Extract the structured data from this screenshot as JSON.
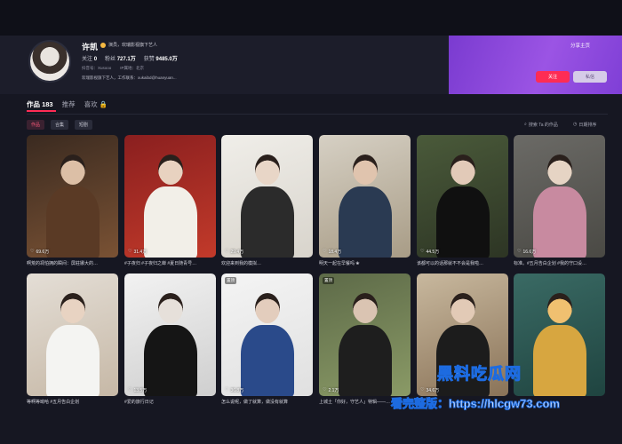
{
  "profile": {
    "name": "许凯",
    "verification": "演员，欢瑞影视旗下艺人",
    "stats": [
      {
        "label": "关注",
        "value": "0"
      },
      {
        "label": "粉丝",
        "value": "727.1万"
      },
      {
        "label": "获赞",
        "value": "9485.0万"
      }
    ],
    "meta": [
      "抖音号：Xusooo",
      "IP属地：北京"
    ],
    "bio": "欢瑞影视旗下艺人，工作联系：xukaibd@huanyuan...",
    "share_label": "分享主页",
    "follow_label": "关注",
    "message_label": "私信"
  },
  "tabs": [
    {
      "label": "作品 183",
      "active": true
    },
    {
      "label": "推荐",
      "active": false
    },
    {
      "label": "喜欢",
      "active": false,
      "locked": true
    }
  ],
  "chips": [
    {
      "label": "作品",
      "active": true
    },
    {
      "label": "合集",
      "active": false
    },
    {
      "label": "短剧",
      "active": false
    }
  ],
  "toolbar": {
    "search_works": "搜索 Ta 的作品",
    "sort": "日期排序"
  },
  "videos": [
    {
      "likes": "69.6万",
      "caption": "啊荒的凋怕拥的瞬间：屏莊娜大的…",
      "bg": [
        "#3a2a20",
        "#7a5234"
      ],
      "skin": "#dcbfa6",
      "cloth": "#5a3a25",
      "pinned": false
    },
    {
      "likes": "31.4万",
      "caption": "#子夜归 #子夜归之蝉 #夏日随青号…",
      "bg": [
        "#8a1f1f",
        "#c23a2a"
      ],
      "skin": "#e8d2c0",
      "cloth": "#f2efe8",
      "pinned": false
    },
    {
      "likes": "29.4万",
      "caption": "欢迎来到我的模拟…",
      "bg": [
        "#f0eee9",
        "#d8d4cc"
      ],
      "skin": "#e8d6c7",
      "cloth": "#2b2b2b",
      "pinned": false
    },
    {
      "likes": "18.4万",
      "caption": "明天一起在早餐吗 ❀",
      "bg": [
        "#d6d0c4",
        "#a89c86"
      ],
      "skin": "#e0c4ae",
      "cloth": "#2a3a52",
      "pinned": false
    },
    {
      "likes": "44.5万",
      "caption": "该都可以的话那就不不会是我啦…",
      "bg": [
        "#4a5a3a",
        "#2d3524"
      ],
      "skin": "#e2cab8",
      "cloth": "#101010",
      "pinned": false
    },
    {
      "likes": "16.6万",
      "caption": "标准。#五月告白企划 #我的守口设…",
      "bg": [
        "#6b6a66",
        "#4a4944"
      ],
      "skin": "#e6d4c4",
      "cloth": "#c88aa0",
      "pinned": false
    },
    {
      "likes": "",
      "caption": "等啊等呦哈 #五月告白企划",
      "bg": [
        "#e4ded6",
        "#c6b8a6"
      ],
      "skin": "#e8d3c2",
      "cloth": "#f4f4f2",
      "pinned": false
    },
    {
      "likes": "13.5万",
      "caption": "#爱的旅行日记",
      "bg": [
        "#f2f2f2",
        "#cfcfcf"
      ],
      "skin": "#e6e0da",
      "cloth": "#151515",
      "pinned": false
    },
    {
      "likes": "36.8万",
      "caption": "怎么说呢，做了就算，做没有就算",
      "bg": [
        "#f4f4f4",
        "#e0e0e0"
      ],
      "skin": "#e3cdbd",
      "cloth": "#2a4a8a",
      "pinned": true,
      "pin_label": "置顶"
    },
    {
      "likes": "2.1万",
      "caption": "上城土「你好，守艺人」特辑——…",
      "bg": [
        "#5d6a48",
        "#8a9a66"
      ],
      "skin": "#dac4b2",
      "cloth": "#1e1e1e",
      "pinned": true,
      "pin_label": "置顶"
    },
    {
      "likes": "34.6万",
      "caption": "",
      "bg": [
        "#c8b89e",
        "#8a7358"
      ],
      "skin": "#e2cab6",
      "cloth": "#1c1c1c",
      "pinned": false
    },
    {
      "likes": "",
      "caption": "",
      "bg": [
        "#3a6a64",
        "#1f4440"
      ],
      "skin": "#f0c070",
      "cloth": "#d7a640",
      "pinned": false
    }
  ],
  "watermark": {
    "line1": "黑料吃瓜网",
    "line2": "看完整版：https://hlcgw73.com",
    "brand_color": "#1d6be0"
  }
}
